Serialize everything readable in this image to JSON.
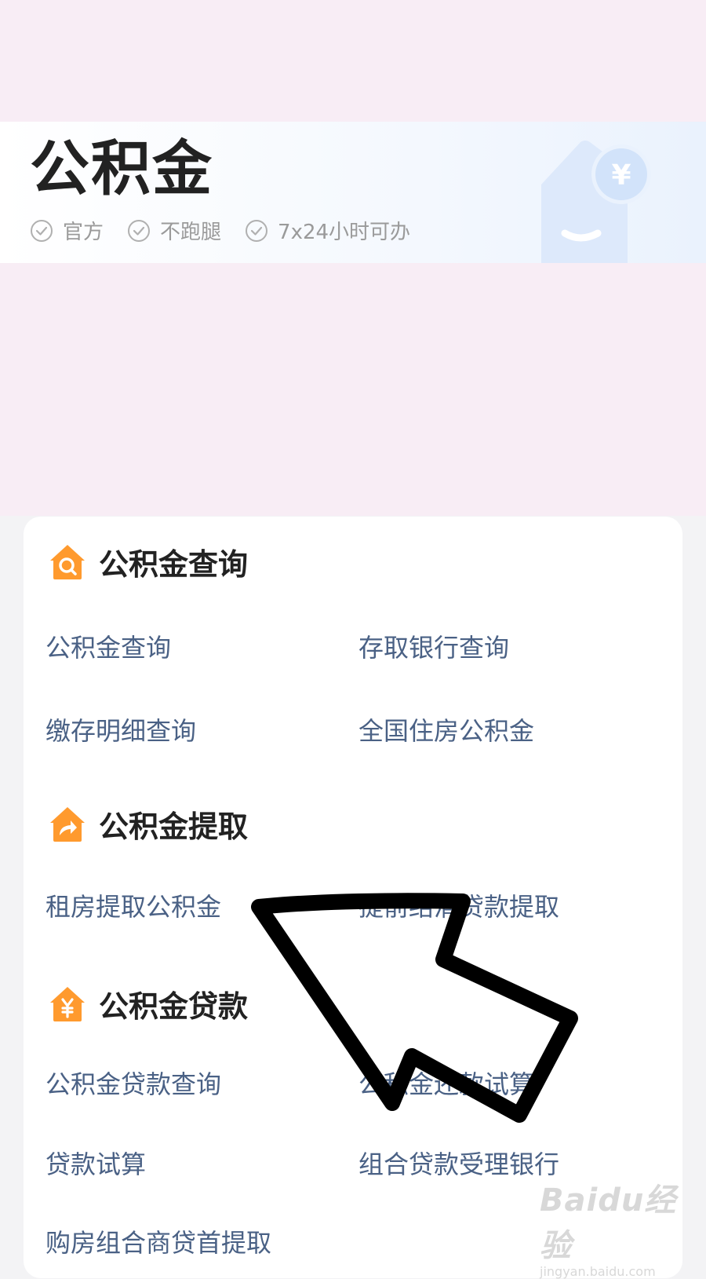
{
  "header": {
    "title": "公积金",
    "tags": [
      "官方",
      "不跑腿",
      "7x24小时可办"
    ],
    "badge_symbol": "¥"
  },
  "sections": [
    {
      "title": "公积金查询",
      "icon": "house-search-icon",
      "items": [
        "公积金查询",
        "存取银行查询",
        "缴存明细查询",
        "全国住房公积金"
      ]
    },
    {
      "title": "公积金提取",
      "icon": "house-share-icon",
      "items": [
        "租房提取公积金",
        "提前结清贷款提取"
      ]
    },
    {
      "title": "公积金贷款",
      "icon": "house-yen-icon",
      "items": [
        "公积金贷款查询",
        "公积金还款试算",
        "贷款试算",
        "组合贷款受理银行",
        "购房组合商贷首提取"
      ]
    }
  ],
  "watermark": {
    "brand": "Baidu经验",
    "url": "jingyan.baidu.com"
  },
  "colors": {
    "accent_orange": "#ff9a2e",
    "link_text": "#4a6185",
    "pink_bg": "#f8edf5"
  }
}
